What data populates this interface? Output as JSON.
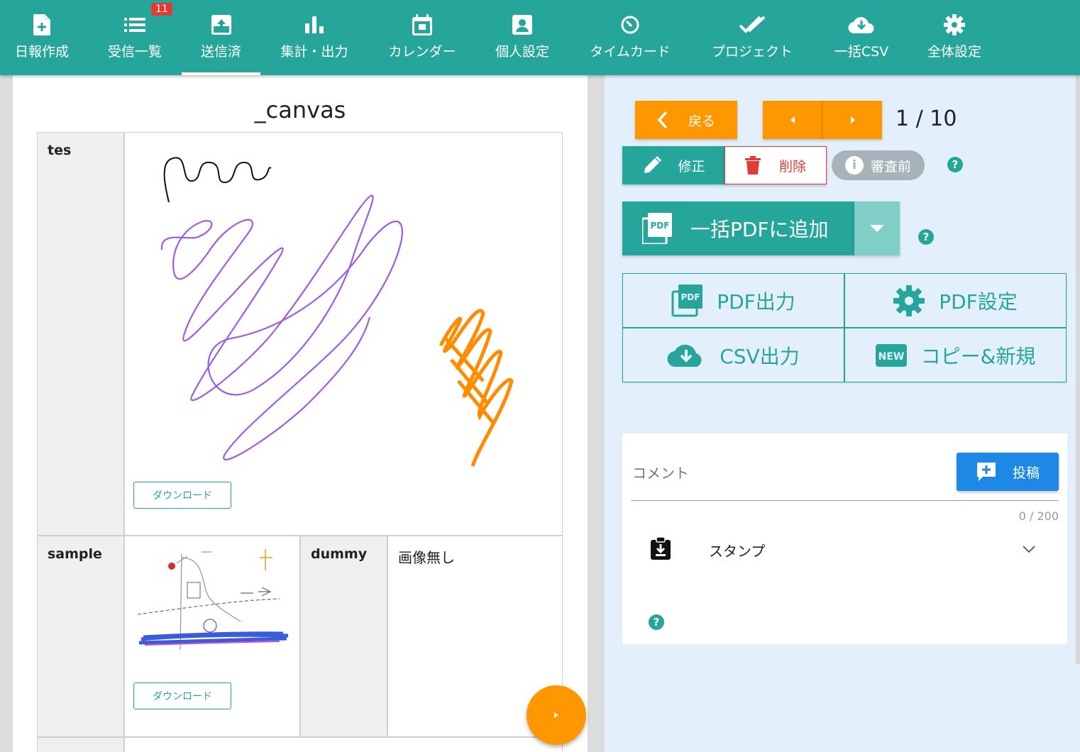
{
  "nav": {
    "items": [
      {
        "label": "日報作成",
        "icon": "add-document-icon"
      },
      {
        "label": "受信一覧",
        "icon": "list-icon",
        "badge": "11"
      },
      {
        "label": "送信済",
        "icon": "outbox-icon",
        "active": true
      },
      {
        "label": "集計・出力",
        "icon": "bar-chart-icon"
      },
      {
        "label": "カレンダー",
        "icon": "calendar-icon"
      },
      {
        "label": "個人設定",
        "icon": "person-icon"
      },
      {
        "label": "タイムカード",
        "icon": "timer-icon"
      },
      {
        "label": "プロジェクト",
        "icon": "double-check-icon"
      },
      {
        "label": "一括CSV",
        "icon": "cloud-download-icon"
      },
      {
        "label": "全体設定",
        "icon": "gear-icon"
      }
    ]
  },
  "report": {
    "title": "_canvas",
    "fields": {
      "tes": {
        "label": "tes",
        "download_label": "ダウンロード"
      },
      "sample": {
        "label": "sample",
        "download_label": "ダウンロード"
      },
      "dummy": {
        "label": "dummy",
        "value": "画像無し"
      }
    }
  },
  "controls": {
    "back_label": "戻る",
    "page_indicator": "1 / 10",
    "edit_label": "修正",
    "delete_label": "削除",
    "status_label": "審査前",
    "bulk_pdf_label": "一括PDFに追加",
    "help_glyph": "?",
    "grid": {
      "pdf_output": "PDF出力",
      "pdf_settings": "PDF設定",
      "csv_output": "CSV出力",
      "copy_new": "コピー&新規"
    }
  },
  "comment": {
    "placeholder": "コメント",
    "counter": "0 / 200",
    "post_label": "投稿",
    "stamp_label": "スタンプ"
  },
  "colors": {
    "primary": "#26a69a",
    "accent_orange": "#ff9800",
    "danger": "#e53935",
    "post_blue": "#1e88e5",
    "panel_bg": "#e3f0fb"
  }
}
